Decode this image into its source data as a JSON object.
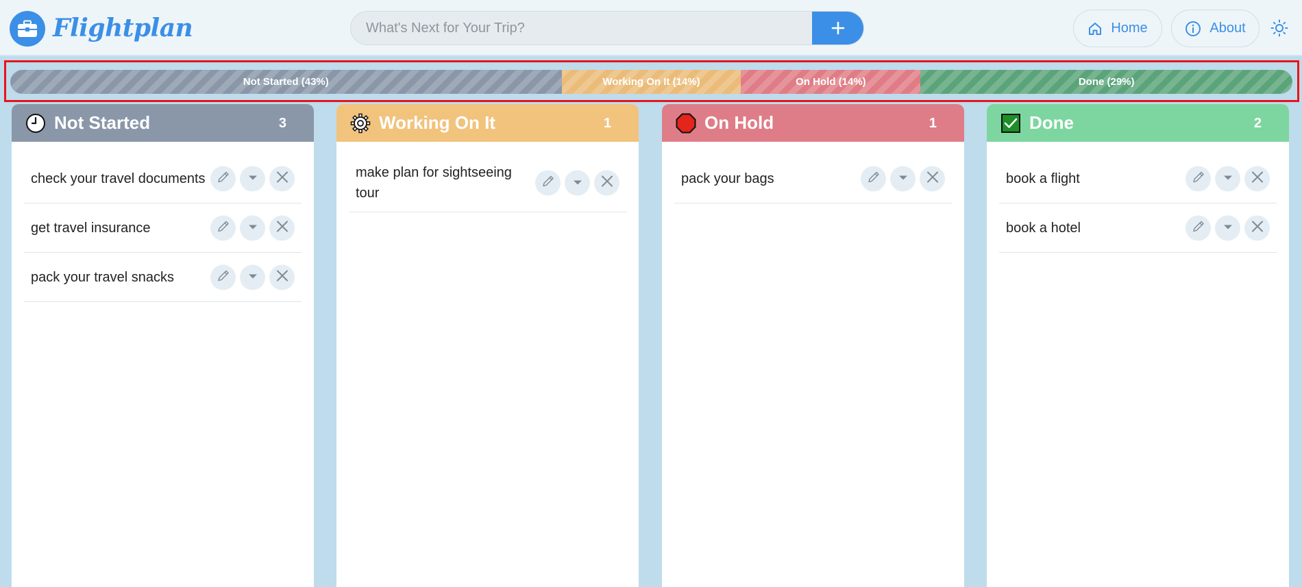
{
  "app": {
    "title": "Flightplan",
    "brand_color": "#3b8fe6"
  },
  "search": {
    "placeholder": "What's Next for Your Trip?",
    "value": ""
  },
  "nav": {
    "home_label": "Home",
    "about_label": "About"
  },
  "progress": [
    {
      "label": "Not Started (43%)",
      "percent": 43,
      "color": "#8a97a9"
    },
    {
      "label": "Working On It (14%)",
      "percent": 14,
      "color": "#ebbc79"
    },
    {
      "label": "On Hold (14%)",
      "percent": 14,
      "color": "#e07c85"
    },
    {
      "label": "Done (29%)",
      "percent": 29,
      "color": "#5ba47a"
    }
  ],
  "columns": [
    {
      "title": "Not Started",
      "count": "3",
      "color": "#8a97a9",
      "icon": "clock-icon",
      "tasks": [
        {
          "text": "check your travel documents"
        },
        {
          "text": "get travel insurance"
        },
        {
          "text": "pack your travel snacks"
        }
      ]
    },
    {
      "title": "Working On It",
      "count": "1",
      "color": "#f1c37d",
      "icon": "gear-icon",
      "tasks": [
        {
          "text": "make plan for sightseeing tour"
        }
      ]
    },
    {
      "title": "On Hold",
      "count": "1",
      "color": "#de7d87",
      "icon": "stop-sign-icon",
      "tasks": [
        {
          "text": "pack your bags"
        }
      ]
    },
    {
      "title": "Done",
      "count": "2",
      "color": "#7dd6a0",
      "icon": "check-box-icon",
      "tasks": [
        {
          "text": "book a flight"
        },
        {
          "text": "book a hotel"
        }
      ]
    }
  ]
}
